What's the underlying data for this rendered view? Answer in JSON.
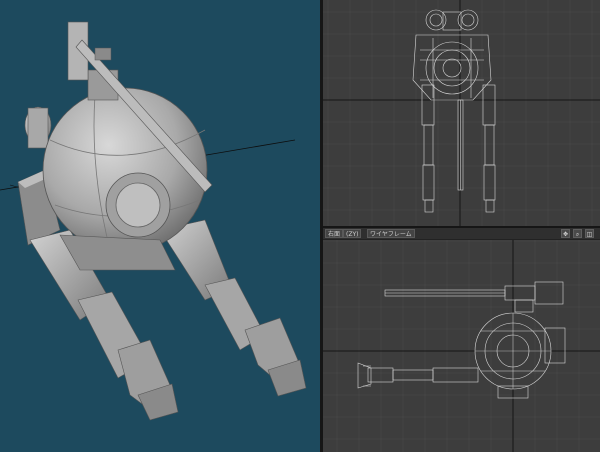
{
  "app": {
    "background": "#1a1a1a"
  },
  "viewports": {
    "perspective": {
      "name": "perspective",
      "background": "#1d4a5e",
      "render_mode": "shaded"
    },
    "top": {
      "name": "top",
      "background": "#3d3d3d",
      "render_mode": "wireframe"
    },
    "side": {
      "name": "side",
      "background": "#3d3d3d",
      "render_mode": "wireframe",
      "header": {
        "view_label": "右面",
        "axis_label": "(ZY)",
        "mode_label": "ワイヤフレーム",
        "buttons": [
          {
            "icon": "move-view-icon",
            "label": "✥"
          },
          {
            "icon": "zoom-view-icon",
            "label": "⌕"
          },
          {
            "icon": "maximize-view-icon",
            "label": "◫"
          }
        ]
      }
    }
  },
  "colors": {
    "grid_line": "#4a4a4a",
    "grid_axis": "#151515",
    "wire": "#d8d8d8",
    "model_light": "#c9c9c9",
    "model_mid": "#9a9a9a",
    "model_dark": "#6e6e6e"
  }
}
